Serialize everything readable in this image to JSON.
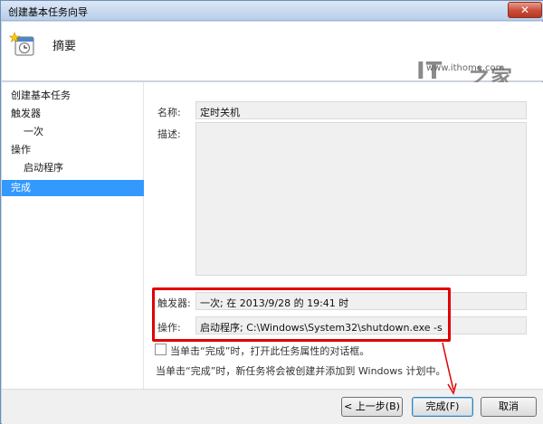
{
  "window": {
    "title": "创建基本任务向导",
    "close_label": "✕"
  },
  "header": {
    "title": "摘要",
    "icon": "calendar-star-icon"
  },
  "brand": {
    "logo_it": "IT",
    "logo_zh": "之家",
    "site": "www.ithome.com"
  },
  "steps": [
    {
      "label": "创建基本任务",
      "level": 0,
      "active": false
    },
    {
      "label": "触发器",
      "level": 0,
      "active": false
    },
    {
      "label": "一次",
      "level": 1,
      "active": false
    },
    {
      "label": "操作",
      "level": 0,
      "active": false
    },
    {
      "label": "启动程序",
      "level": 1,
      "active": false
    },
    {
      "label": "完成",
      "level": 0,
      "active": true
    }
  ],
  "summary": {
    "name_label": "名称:",
    "name_value": "定时关机",
    "desc_label": "描述:",
    "desc_value": "",
    "trigger_label": "触发器:",
    "trigger_value": "一次; 在 2013/9/28 的 19:41 时",
    "action_label": "操作:",
    "action_value": "启动程序; C:\\Windows\\System32\\shutdown.exe -s"
  },
  "options": {
    "open_props_label": "当单击“完成”时，打开此任务属性的对话框。",
    "open_props_checked": false,
    "info_text": "当单击“完成”时，新任务将会被创建并添加到 Windows 计划中。"
  },
  "buttons": {
    "back": "< 上一步(B)",
    "finish": "完成(F)",
    "cancel": "取消"
  },
  "colors": {
    "annotation": "#e00000",
    "selection": "#3399ff"
  }
}
